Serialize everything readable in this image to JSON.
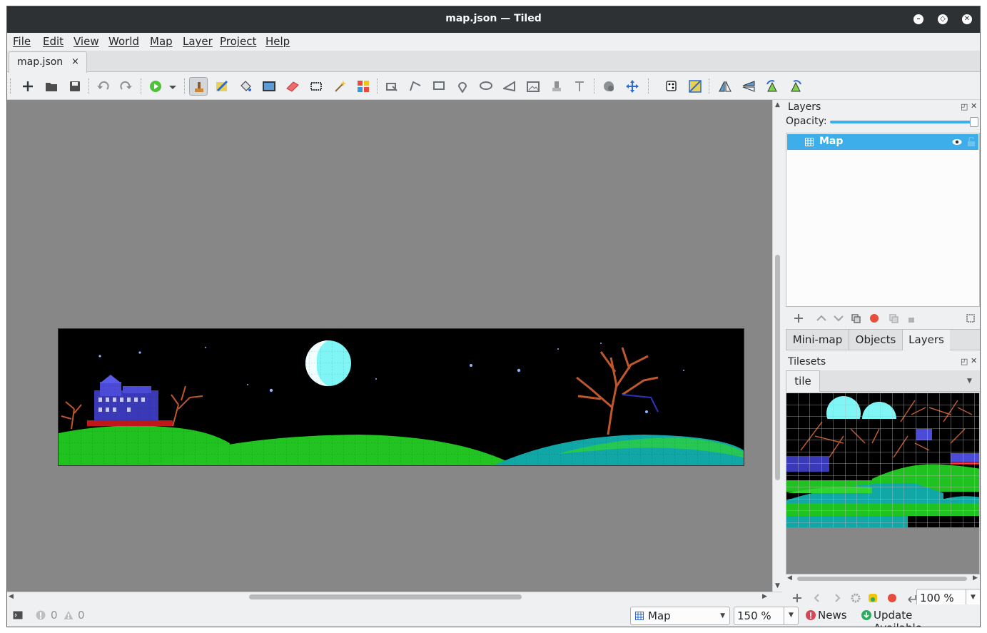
{
  "window": {
    "title": "map.json — Tiled"
  },
  "menu": {
    "items": [
      "File",
      "Edit",
      "View",
      "World",
      "Map",
      "Layer",
      "Project",
      "Help"
    ]
  },
  "document_tab": {
    "label": "map.json",
    "close": "×"
  },
  "toolbar": {
    "icons": [
      "new-icon",
      "open-icon",
      "save-icon",
      "undo-icon",
      "redo-icon",
      "run-icon",
      "stamp-brush-icon",
      "terrain-brush-icon",
      "bucket-fill-icon",
      "shape-fill-icon",
      "eraser-icon",
      "rect-select-icon",
      "magic-wand-icon",
      "select-same-tile-icon",
      "select-objects-icon",
      "edit-polygons-icon",
      "insert-rectangle-icon",
      "insert-point-icon",
      "insert-ellipse-icon",
      "insert-polygon-icon",
      "insert-tile-icon",
      "insert-template-icon",
      "insert-text-icon",
      "worlds-tool-icon",
      "move-icon",
      "random-mode-icon",
      "wang-fill-icon",
      "flip-horizontal-icon",
      "flip-vertical-icon",
      "rotate-left-icon",
      "rotate-right-icon"
    ]
  },
  "layers_panel": {
    "title": "Layers",
    "opacity_label": "Opacity:",
    "opacity_value": 1.0,
    "layers": [
      {
        "name": "Map",
        "visible": true,
        "locked": false
      }
    ]
  },
  "mini_tabs": {
    "items": [
      "Mini-map",
      "Objects",
      "Layers"
    ],
    "active": "Layers"
  },
  "tilesets_panel": {
    "title": "Tilesets",
    "tab": "tile",
    "zoom": "100 %"
  },
  "status": {
    "errors": "0",
    "warnings": "0",
    "layer": "Map",
    "zoom": "150 %",
    "news": "News",
    "update": "Update Available"
  },
  "colors": {
    "accent": "#3daee9",
    "titlebar": "#2e3134",
    "canvas": "#878787",
    "grass": "#1fc21f",
    "teal": "#12a7a7",
    "moon": "#7ff5f5",
    "house": "#4b4bd8",
    "tree": "#c0582c"
  }
}
